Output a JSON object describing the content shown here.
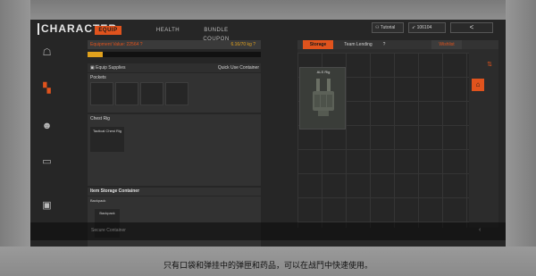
{
  "header": {
    "title": "CHARACTER",
    "tabs": [
      "EQUIP",
      "HEALTH",
      "BUNDLE COUPON"
    ],
    "tutorial_label": "Tutorial",
    "currency_amount": "106104",
    "back_label": "<"
  },
  "sidebar": {
    "icons": [
      "pistol-icon",
      "vest-icon",
      "head-icon",
      "case-icon",
      "locker-icon"
    ]
  },
  "equipment": {
    "value_label": "Equipment Value: 22564",
    "value_help": "?",
    "weight": "6.16/70 kg",
    "weight_help": "?",
    "weight_fraction": 0.088,
    "limit_mark": "",
    "supplies_label": "Equip Supplies",
    "quick_use_label": "Quick Use Container",
    "pockets_label": "Pockets",
    "chest_rig_label": "Chest Rig",
    "chest_rig_slot": "Tactical Chest Rig",
    "storage_container_label": "Item Storage Container",
    "backpack_label": "Backpack",
    "backpack_slot": "Backpack",
    "secure_container_label": "Secure Container"
  },
  "storage": {
    "tabs": [
      "Storage",
      "Team Lending",
      "?"
    ],
    "wishlist_label": "Wishlist",
    "item_name": "ALS Rig"
  },
  "subtitle": "只有口袋和弹挂中的弹匣和药品，可以在战鬥中快速使用。"
}
